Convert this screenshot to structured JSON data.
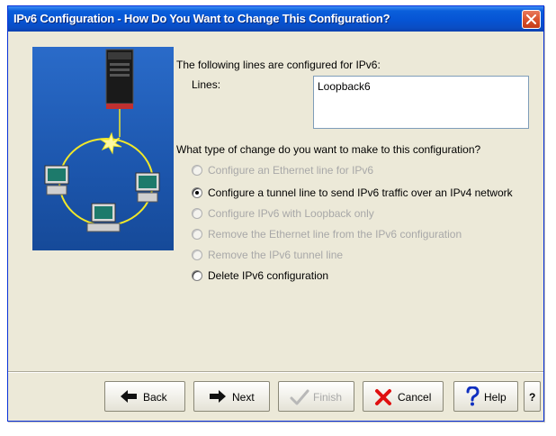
{
  "window": {
    "title": "IPv6 Configuration - How Do You Want to Change This Configuration?"
  },
  "intro": {
    "text": "The following lines are configured for IPv6:",
    "lines_label": "Lines:",
    "lines": [
      "Loopback6"
    ]
  },
  "question": "What type of change do you want to make to this configuration?",
  "options": [
    {
      "label": "Configure an Ethernet line for IPv6",
      "enabled": false,
      "selected": false
    },
    {
      "label": "Configure a tunnel line to send IPv6 traffic over an IPv4 network",
      "enabled": true,
      "selected": true
    },
    {
      "label": "Configure IPv6 with Loopback only",
      "enabled": false,
      "selected": false
    },
    {
      "label": "Remove the Ethernet line from the IPv6 configuration",
      "enabled": false,
      "selected": false
    },
    {
      "label": "Remove the IPv6 tunnel line",
      "enabled": false,
      "selected": false
    },
    {
      "label": "Delete IPv6 configuration",
      "enabled": true,
      "selected": false
    }
  ],
  "buttons": {
    "back": "Back",
    "next": "Next",
    "finish": "Finish",
    "cancel": "Cancel",
    "help": "Help",
    "question": "?"
  },
  "icons": {
    "back": "left-arrow-icon",
    "next": "right-arrow-icon",
    "finish": "checkmark-icon",
    "cancel": "red-x-icon",
    "help": "question-mark-icon",
    "close": "close-icon"
  },
  "colors": {
    "titlebar": "#0654d4",
    "window_bg": "#ece9d8",
    "close": "#d9532f",
    "illustration_bg": "#1c56ad",
    "ring": "#f2e829",
    "disabled_text": "#a8a8a8",
    "cancel_x": "#e01010",
    "help_q": "#1030c0"
  }
}
